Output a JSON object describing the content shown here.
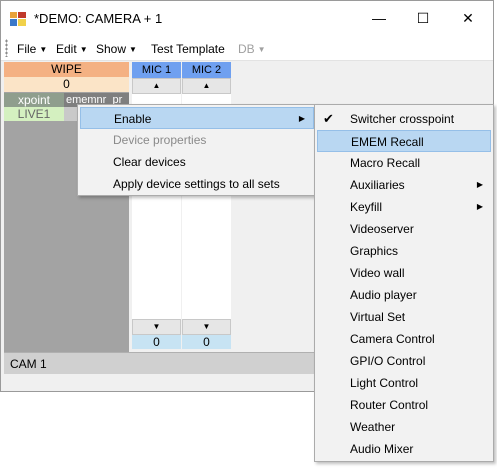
{
  "window": {
    "title": "*DEMO: CAMERA + 1",
    "controls": {
      "minimize": "—",
      "maximize": "☐",
      "close": "✕"
    }
  },
  "menubar": {
    "items": [
      {
        "label": "File",
        "arrow": "▼"
      },
      {
        "label": "Edit",
        "arrow": "▼"
      },
      {
        "label": "Show",
        "arrow": "▼"
      },
      {
        "label": "Test Template",
        "arrow": ""
      },
      {
        "label": "DB",
        "arrow": "▼"
      }
    ]
  },
  "left_panel": {
    "wipe_label": "WIPE",
    "wipe_value": "0",
    "xpoint_label": "xpoint",
    "ememnr_label": "ememnr_pr",
    "live_label": "LIVE1"
  },
  "mic_columns": [
    {
      "header": "MIC 1",
      "value": "0",
      "up": "▲",
      "down": "▼"
    },
    {
      "header": "MIC 2",
      "value": "0",
      "up": "▲",
      "down": "▼"
    }
  ],
  "statusbar": {
    "text": "CAM 1"
  },
  "context_menu": {
    "items": [
      {
        "label": "Enable",
        "state": "highlighted",
        "submenu": "▶"
      },
      {
        "label": "Device properties",
        "state": "disabled"
      },
      {
        "label": "Clear devices",
        "state": "normal"
      },
      {
        "label": "Apply device settings to all sets",
        "state": "normal"
      }
    ]
  },
  "submenu": {
    "items": [
      {
        "label": "Switcher crosspoint",
        "checked": true,
        "mark": "✔"
      },
      {
        "label": "EMEM Recall",
        "highlighted": true
      },
      {
        "label": "Macro Recall"
      },
      {
        "label": "Auxiliaries",
        "submenu": "▶"
      },
      {
        "label": "Keyfill",
        "submenu": "▶"
      },
      {
        "label": "Videoserver"
      },
      {
        "label": "Graphics"
      },
      {
        "label": "Video wall"
      },
      {
        "label": "Audio player"
      },
      {
        "label": "Virtual Set"
      },
      {
        "label": "Camera Control"
      },
      {
        "label": "GPI/O Control"
      },
      {
        "label": "Light Control"
      },
      {
        "label": "Router Control"
      },
      {
        "label": "Weather"
      },
      {
        "label": "Audio Mixer"
      }
    ]
  },
  "colors": {
    "wipe": "#f4b183",
    "mic_header": "#6fa0f0",
    "highlight": "#b9d7f2",
    "panel_grey": "#a3a3a3"
  }
}
